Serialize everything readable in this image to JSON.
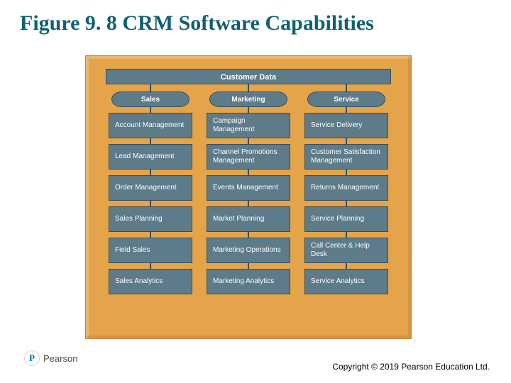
{
  "title": "Figure 9. 8 CRM Software Capabilities",
  "headerLabel": "Customer Data",
  "columns": [
    {
      "pill": "Sales",
      "boxes": [
        "Account Management",
        "Lead Management",
        "Order Management",
        "Sales Planning",
        "Field Sales",
        "Sales Analytics"
      ]
    },
    {
      "pill": "Marketing",
      "boxes": [
        "Campaign Management",
        "Channel Promotions Management",
        "Events Management",
        "Market Planning",
        "Marketing Operations",
        "Marketing Analytics"
      ]
    },
    {
      "pill": "Service",
      "boxes": [
        "Service Delivery",
        "Customer Satisfaction Management",
        "Returns Management",
        "Service Planning",
        "Call Center & Help Desk",
        "Service Analytics"
      ]
    }
  ],
  "brand": {
    "initial": "P",
    "name": "Pearson"
  },
  "copyright": "Copyright © 2019 Pearson Education Ltd.",
  "colors": {
    "frame": "#e5a44a",
    "box": "#5e7b8a",
    "titleColor": "#0f6171"
  }
}
